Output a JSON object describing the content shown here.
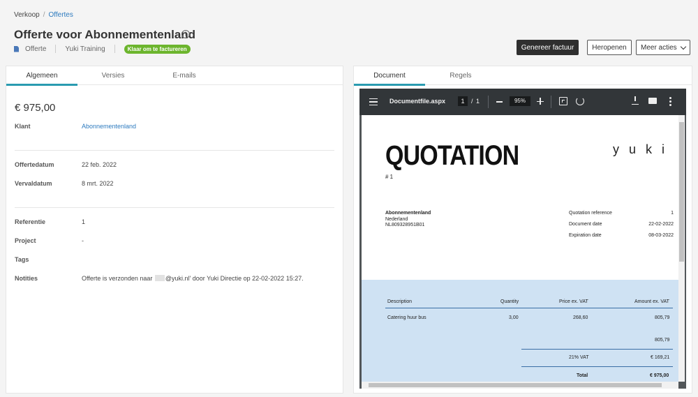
{
  "breadcrumb": {
    "root": "Verkoop",
    "separator": "/",
    "current": "Offertes"
  },
  "page": {
    "title": "Offerte voor Abonnementenland"
  },
  "meta": {
    "type": "Offerte",
    "domain": "Yuki Training",
    "status": "Klaar om te factureren",
    "status_color": "#6cb52d"
  },
  "actions": {
    "generate_invoice": "Genereer factuur",
    "reopen": "Heropenen",
    "more": "Meer acties"
  },
  "left_tabs": [
    {
      "label": "Algemeen"
    },
    {
      "label": "Versies"
    },
    {
      "label": "E-mails"
    }
  ],
  "details": {
    "amount": "€ 975,00",
    "customer_label": "Klant",
    "customer_value": "Abonnementenland",
    "date_label": "Offertedatum",
    "date_value": "22 feb. 2022",
    "expiry_label": "Vervaldatum",
    "expiry_value": "8 mrt. 2022",
    "reference_label": "Referentie",
    "reference_value": "1",
    "project_label": "Project",
    "project_value": "-",
    "tags_label": "Tags",
    "notes_label": "Notities",
    "notes_prefix": "Offerte is verzonden naar",
    "notes_suffix": "@yuki.nl' door Yuki Directie op 22-02-2022 15:27."
  },
  "right_tabs": [
    {
      "label": "Document"
    },
    {
      "label": "Regels"
    }
  ],
  "accent_color": "#2a9bb0",
  "pdf": {
    "filename": "Documentfile.aspx",
    "page_current": "1",
    "page_sep": "/",
    "page_total": "1",
    "zoom": "95%",
    "doc": {
      "title": "QUOTATION",
      "number": "# 1",
      "logo": "yuki",
      "customer": {
        "name": "Abonnementenland",
        "country": "Nederland",
        "vat": "NL809328951B01"
      },
      "meta": [
        {
          "label": "Quotation reference",
          "value": "1"
        },
        {
          "label": "Document date",
          "value": "22-02-2022"
        },
        {
          "label": "Expiration date",
          "value": "08-03-2022"
        }
      ],
      "columns": {
        "description": "Description",
        "quantity": "Quantity",
        "price": "Price ex. VAT",
        "amount": "Amount ex. VAT"
      },
      "lines": [
        {
          "description": "Catering huur bus",
          "quantity": "3,00",
          "price": "268,60",
          "amount": "805,79"
        }
      ],
      "subtotal": "805,79",
      "vat_label": "21% VAT",
      "vat_value": "€ 169,21",
      "total_label": "Total",
      "total_value": "€ 975,00"
    }
  }
}
